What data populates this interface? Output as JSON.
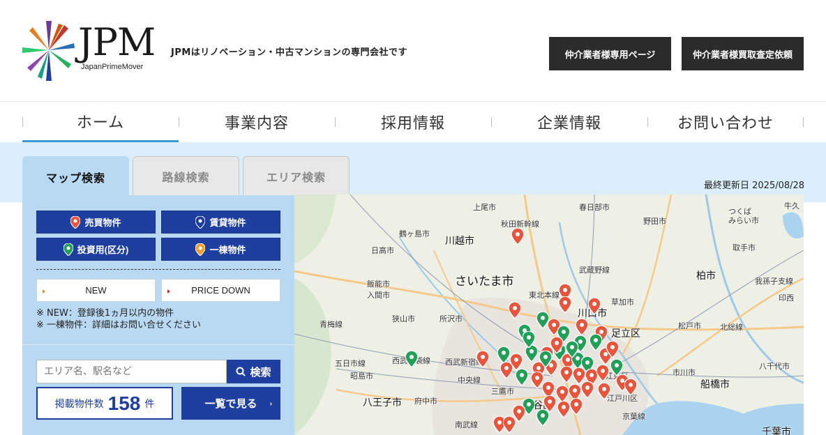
{
  "header": {
    "logo_text": "JPM",
    "logo_sub": "JapanPrimeMover",
    "tagline": "JPMはリノベーション・中古マンションの専門会社です",
    "btn_agent_page": "仲介業者様専用ページ",
    "btn_appraisal": "仲介業者様買取査定依頼"
  },
  "nav": {
    "items": [
      "ホーム",
      "事業内容",
      "採用情報",
      "企業情報",
      "お問い合わせ"
    ],
    "active": "ホーム"
  },
  "search": {
    "tabs": [
      "マップ検索",
      "路線検索",
      "エリア検索"
    ],
    "active_tab": "マップ検索",
    "updated_label": "最終更新日 2025/08/28",
    "categories": [
      "売買物件",
      "賃貸物件",
      "投資用(区分)",
      "一棟物件"
    ],
    "category_colors": [
      "#e8543c",
      "#1f3fa0",
      "#22a05a",
      "#f0a02a"
    ],
    "tags": [
      "NEW",
      "PRICE DOWN"
    ],
    "notes": [
      "※ NEW：登録後1ヵ月以内の物件",
      "※ 一棟物件：詳細はお問い合せください"
    ],
    "keyword_placeholder": "エリア名、駅名など",
    "keyword_button": "検索",
    "count_label": "掲載物件数",
    "count_value": "158",
    "count_unit": "件",
    "list_button": "一覧で見る"
  },
  "map": {
    "labels": [
      "上尾市",
      "春日部市",
      "野田市",
      "つくば",
      "みらい市",
      "牛久",
      "鶴ヶ島市",
      "川越市",
      "日高市",
      "取手市",
      "柏市",
      "さいたま市",
      "武蔵野線",
      "我孫子支線",
      "飯能市",
      "入間市",
      "川口市",
      "草加市",
      "足立区",
      "印西",
      "所沢市",
      "松戸市",
      "北総線",
      "青梅線",
      "狭山市",
      "西武池袋線",
      "五日市線",
      "西武新宿線",
      "市川市",
      "八千代市",
      "昭島市",
      "中央線",
      "三鷹市",
      "江東区",
      "船橋市",
      "八王子市",
      "府中市",
      "渋谷区",
      "江戸川区",
      "京葉線",
      "南武線",
      "千葉市",
      "東北本線",
      "秋田新幹線"
    ]
  }
}
